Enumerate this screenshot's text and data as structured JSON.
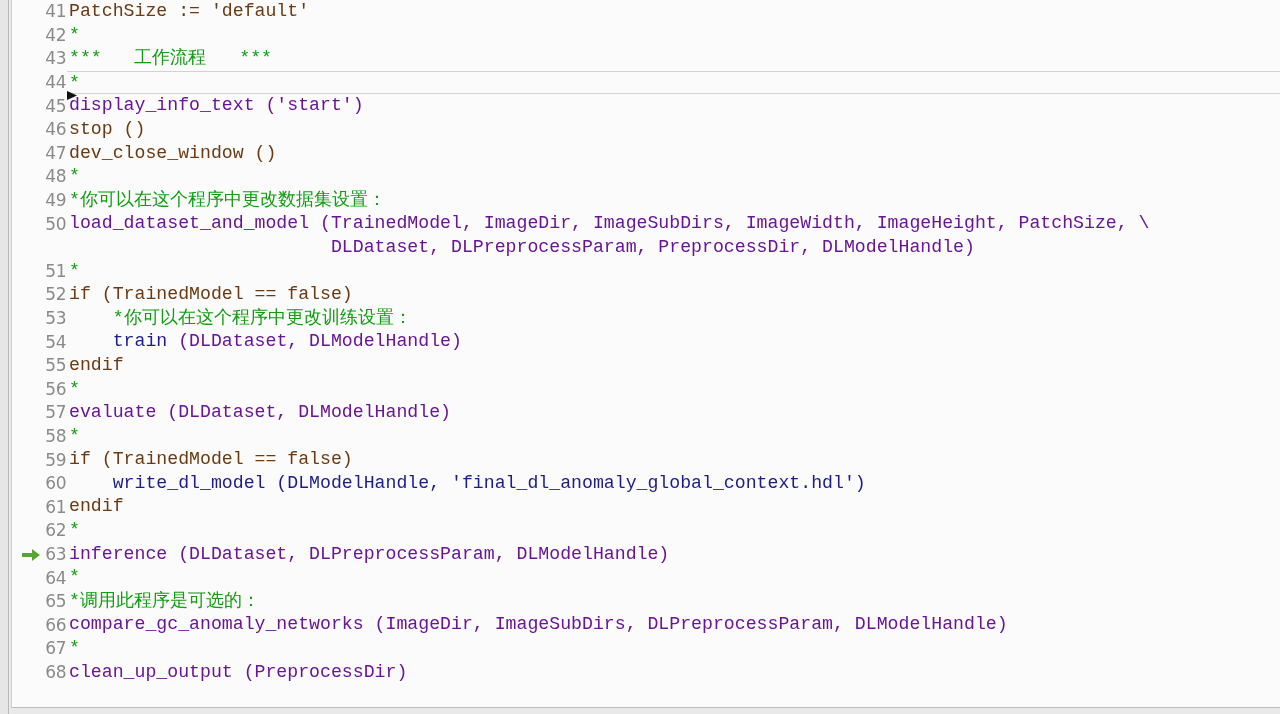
{
  "editor": {
    "lines": [
      {
        "number": "41",
        "current": false,
        "cursor": false,
        "program_counter": false,
        "segments": [
          {
            "text": "PatchSize := 'default'",
            "kind": "control"
          }
        ]
      },
      {
        "number": "42",
        "current": false,
        "cursor": false,
        "program_counter": false,
        "segments": [
          {
            "text": "*",
            "kind": "comment"
          }
        ]
      },
      {
        "number": "43",
        "current": false,
        "cursor": false,
        "program_counter": false,
        "segments": [
          {
            "text": "***   工作流程   ***",
            "kind": "comment"
          }
        ]
      },
      {
        "number": "44",
        "current": true,
        "cursor": true,
        "program_counter": false,
        "segments": [
          {
            "text": "*",
            "kind": "comment"
          }
        ]
      },
      {
        "number": "45",
        "current": false,
        "cursor": false,
        "program_counter": false,
        "segments": [
          {
            "text": "display_info_text ('start')",
            "kind": "procedure"
          }
        ]
      },
      {
        "number": "46",
        "current": false,
        "cursor": false,
        "program_counter": false,
        "segments": [
          {
            "text": "stop ()",
            "kind": "control"
          }
        ]
      },
      {
        "number": "47",
        "current": false,
        "cursor": false,
        "program_counter": false,
        "segments": [
          {
            "text": "dev_close_window ()",
            "kind": "control"
          }
        ]
      },
      {
        "number": "48",
        "current": false,
        "cursor": false,
        "program_counter": false,
        "segments": [
          {
            "text": "*",
            "kind": "comment"
          }
        ]
      },
      {
        "number": "49",
        "current": false,
        "cursor": false,
        "program_counter": false,
        "segments": [
          {
            "text": "*你可以在这个程序中更改数据集设置：",
            "kind": "comment"
          }
        ]
      },
      {
        "number": "50",
        "current": false,
        "cursor": false,
        "program_counter": false,
        "segments": [
          {
            "text": "load_dataset_and_model (TrainedModel, ImageDir, ImageSubDirs, ImageWidth, ImageHeight, PatchSize, \\",
            "kind": "procedure"
          }
        ],
        "continuation": [
          {
            "text": "                        DLDataset, DLPreprocessParam, PreprocessDir, DLModelHandle)",
            "kind": "procedure"
          }
        ]
      },
      {
        "number": "51",
        "current": false,
        "cursor": false,
        "program_counter": false,
        "segments": [
          {
            "text": "*",
            "kind": "comment"
          }
        ]
      },
      {
        "number": "52",
        "current": false,
        "cursor": false,
        "program_counter": false,
        "segments": [
          {
            "text": "if (TrainedModel == false)",
            "kind": "control"
          }
        ]
      },
      {
        "number": "53",
        "current": false,
        "cursor": false,
        "program_counter": false,
        "segments": [
          {
            "text": "    *你可以在这个程序中更改训练设置：",
            "kind": "comment"
          }
        ]
      },
      {
        "number": "54",
        "current": false,
        "cursor": false,
        "program_counter": false,
        "segments": [
          {
            "text": "    train",
            "kind": "operator"
          },
          {
            "text": " (DLDataset, DLModelHandle)",
            "kind": "procedure"
          }
        ]
      },
      {
        "number": "55",
        "current": false,
        "cursor": false,
        "program_counter": false,
        "segments": [
          {
            "text": "endif",
            "kind": "control"
          }
        ]
      },
      {
        "number": "56",
        "current": false,
        "cursor": false,
        "program_counter": false,
        "segments": [
          {
            "text": "*",
            "kind": "comment"
          }
        ]
      },
      {
        "number": "57",
        "current": false,
        "cursor": false,
        "program_counter": false,
        "segments": [
          {
            "text": "evaluate (DLDataset, DLModelHandle)",
            "kind": "procedure"
          }
        ]
      },
      {
        "number": "58",
        "current": false,
        "cursor": false,
        "program_counter": false,
        "segments": [
          {
            "text": "*",
            "kind": "comment"
          }
        ]
      },
      {
        "number": "59",
        "current": false,
        "cursor": false,
        "program_counter": false,
        "segments": [
          {
            "text": "if (TrainedModel == false)",
            "kind": "control"
          }
        ]
      },
      {
        "number": "60",
        "current": false,
        "cursor": false,
        "program_counter": false,
        "segments": [
          {
            "text": "    write_dl_model (DLModelHandle, 'final_dl_anomaly_global_context.hdl')",
            "kind": "operator"
          }
        ]
      },
      {
        "number": "61",
        "current": false,
        "cursor": false,
        "program_counter": false,
        "segments": [
          {
            "text": "endif",
            "kind": "control"
          }
        ]
      },
      {
        "number": "62",
        "current": false,
        "cursor": false,
        "program_counter": false,
        "segments": [
          {
            "text": "*",
            "kind": "comment"
          }
        ]
      },
      {
        "number": "63",
        "current": false,
        "cursor": false,
        "program_counter": true,
        "segments": [
          {
            "text": "inference (DLDataset, DLPreprocessParam, DLModelHandle)",
            "kind": "procedure"
          }
        ]
      },
      {
        "number": "64",
        "current": false,
        "cursor": false,
        "program_counter": false,
        "segments": [
          {
            "text": "*",
            "kind": "comment"
          }
        ]
      },
      {
        "number": "65",
        "current": false,
        "cursor": false,
        "program_counter": false,
        "segments": [
          {
            "text": "*调用此程序是可选的：",
            "kind": "comment"
          }
        ]
      },
      {
        "number": "66",
        "current": false,
        "cursor": false,
        "program_counter": false,
        "segments": [
          {
            "text": "compare_gc_anomaly_networks (ImageDir, ImageSubDirs, DLPreprocessParam, DLModelHandle)",
            "kind": "procedure"
          }
        ]
      },
      {
        "number": "67",
        "current": false,
        "cursor": false,
        "program_counter": false,
        "segments": [
          {
            "text": "*",
            "kind": "comment"
          }
        ]
      },
      {
        "number": "68",
        "current": false,
        "cursor": false,
        "program_counter": false,
        "segments": [
          {
            "text": "clean_up_output (PreprocessDir)",
            "kind": "procedure"
          }
        ]
      }
    ]
  }
}
